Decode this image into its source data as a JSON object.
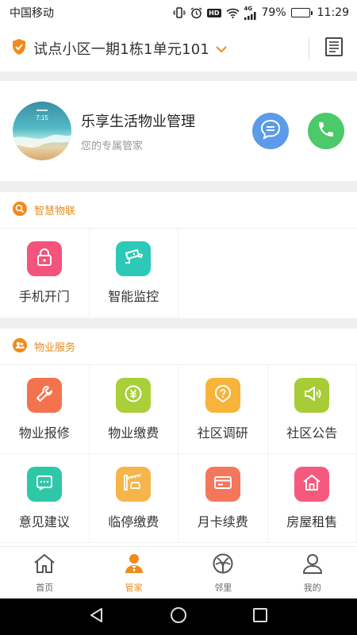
{
  "status_bar": {
    "carrier": "中国移动",
    "hd_label": "HD",
    "network_label": "4G",
    "battery_percent": "79%",
    "battery_level": 0.79,
    "time": "11:29"
  },
  "header": {
    "address": "试点小区一期1栋1单元101",
    "icons": {
      "shield": "shield-check-icon",
      "dropdown": "chevron-down-icon",
      "doc": "document-list-icon"
    }
  },
  "manager": {
    "avatar_time": "7:15",
    "name": "乐享生活物业管理",
    "subtitle": "您的专属管家"
  },
  "smart_iot": {
    "title": "智慧物联",
    "items": [
      {
        "label": "手机开门",
        "icon": "lock-icon",
        "color": "#f2547c"
      },
      {
        "label": "智能监控",
        "icon": "camera-icon",
        "color": "#2cc9b6"
      }
    ]
  },
  "property_services": {
    "title": "物业服务",
    "items": [
      {
        "label": "物业报修",
        "icon": "wrench-icon",
        "color": "#f3734e"
      },
      {
        "label": "物业缴费",
        "icon": "yuan-coin-icon",
        "color": "#a9cf3a"
      },
      {
        "label": "社区调研",
        "icon": "question-bubble-icon",
        "color": "#f7b33a"
      },
      {
        "label": "社区公告",
        "icon": "speaker-icon",
        "color": "#a7cc36"
      },
      {
        "label": "意见建议",
        "icon": "message-dots-icon",
        "color": "#2ec8a9"
      },
      {
        "label": "临停缴费",
        "icon": "parking-barrier-icon",
        "color": "#f6b54a"
      },
      {
        "label": "月卡续费",
        "icon": "card-icon",
        "color": "#f5775b"
      },
      {
        "label": "房屋租售",
        "icon": "house-icon",
        "color": "#f55a7e"
      }
    ]
  },
  "tab_bar": {
    "active_color": "#f08a1c",
    "tabs": [
      {
        "label": "首页",
        "icon": "home-icon"
      },
      {
        "label": "管家",
        "icon": "butler-icon"
      },
      {
        "label": "邻里",
        "icon": "neighbor-icon"
      },
      {
        "label": "我的",
        "icon": "user-icon"
      }
    ]
  },
  "nav_bar": {
    "icons": [
      "back-triangle-icon",
      "home-circle-icon",
      "recents-square-icon"
    ]
  }
}
